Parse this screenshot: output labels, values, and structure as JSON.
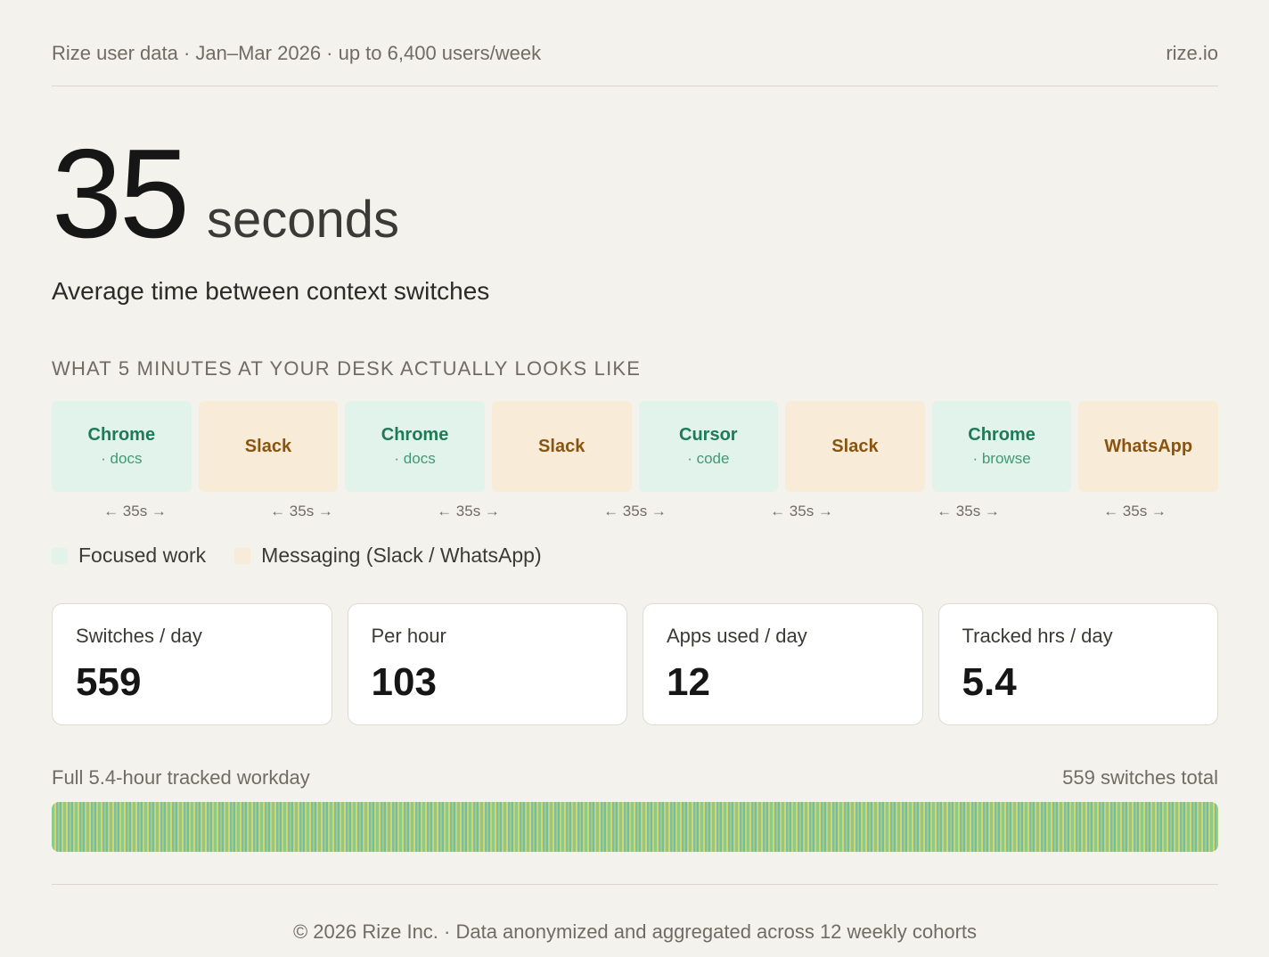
{
  "header": {
    "source": "Rize user data · Jan–Mar 2026 · up to 6,400 users/week",
    "site": "rize.io"
  },
  "hero": {
    "value": "35",
    "unit": "seconds",
    "subtitle": "Average time between context switches"
  },
  "section_title": "WHAT 5 MINUTES AT YOUR DESK ACTUALLY LOOKS LIKE",
  "blocks": [
    {
      "app": "Chrome",
      "sub": "· docs",
      "kind": "focus"
    },
    {
      "app": "Slack",
      "sub": "",
      "kind": "msg"
    },
    {
      "app": "Chrome",
      "sub": "· docs",
      "kind": "focus"
    },
    {
      "app": "Slack",
      "sub": "",
      "kind": "msg"
    },
    {
      "app": "Cursor",
      "sub": "· code",
      "kind": "focus"
    },
    {
      "app": "Slack",
      "sub": "",
      "kind": "msg"
    },
    {
      "app": "Chrome",
      "sub": "· browse",
      "kind": "focus"
    },
    {
      "app": "WhatsApp",
      "sub": "",
      "kind": "msg"
    }
  ],
  "intervals": [
    "← 35s →",
    "← 35s →",
    "← 35s →",
    "← 35s →",
    "← 35s →",
    "← 35s →",
    "← 35s →"
  ],
  "legend": {
    "focus": "Focused work",
    "msg": "Messaging (Slack / WhatsApp)"
  },
  "stats": [
    {
      "label": "Switches / day",
      "value": "559"
    },
    {
      "label": "Per hour",
      "value": "103"
    },
    {
      "label": "Apps used / day",
      "value": "12"
    },
    {
      "label": "Tracked hrs / day",
      "value": "5.4"
    }
  ],
  "timeline": {
    "left": "Full 5.4-hour tracked workday",
    "right": "559 switches total"
  },
  "footer": "© 2026 Rize Inc. · Data anonymized and aggregated across 12 weekly cohorts",
  "colors": {
    "background": "#f4f2ec",
    "focus": "#e2f3ec",
    "focus_text": "#1f7a55",
    "messaging": "#f8ecd8",
    "messaging_text": "#8a5410"
  }
}
